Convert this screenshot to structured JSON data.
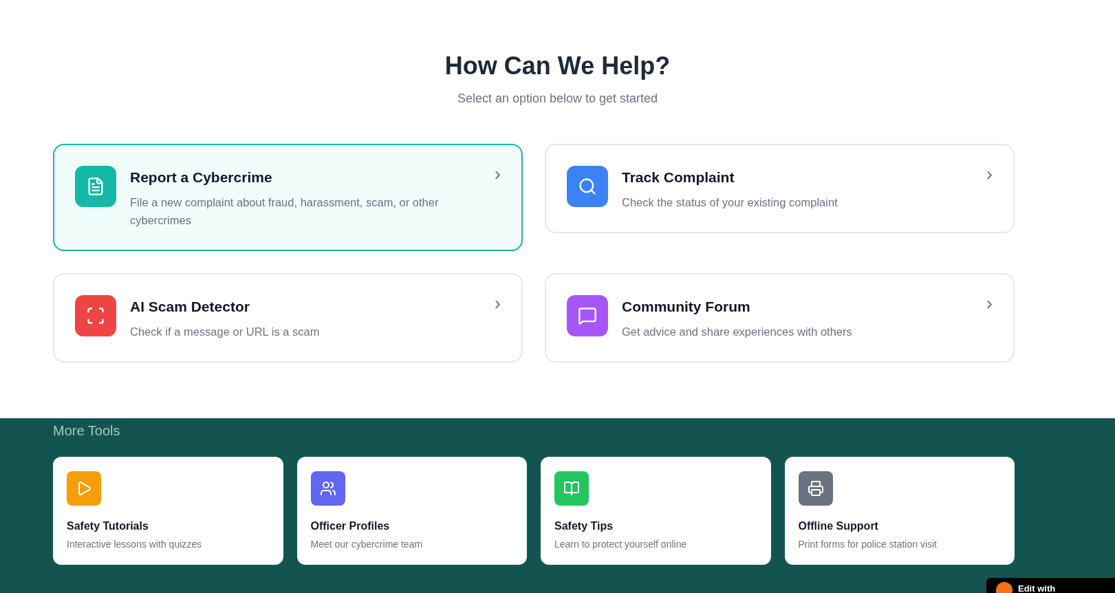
{
  "heading": "How Can We Help?",
  "subtitle": "Select an option below to get started",
  "options": [
    {
      "kind": "document",
      "title": "Report a Cybercrime",
      "description": "File a new complaint about fraud, harassment, scam, or other cybercrimes",
      "selected": true,
      "color": "#14b8a6",
      "chevron": "›"
    },
    {
      "kind": "search",
      "title": "Track Complaint",
      "description": "Check the status of your existing complaint",
      "selected": false,
      "color": "#3b82f6",
      "chevron": "›"
    },
    {
      "kind": "scan",
      "title": "AI Scam Detector",
      "description": "Check if a message or URL is a scam",
      "selected": false,
      "color": "#ef4444",
      "chevron": "›"
    },
    {
      "kind": "chat",
      "title": "Community Forum",
      "description": "Get advice and share experiences with others",
      "selected": false,
      "color": "#a855f7",
      "chevron": "›"
    }
  ],
  "more_tools": {
    "title": "More Tools",
    "items": [
      {
        "kind": "play",
        "title": "Safety Tutorials",
        "description": "Interactive lessons with quizzes",
        "color": "#f59e0b"
      },
      {
        "kind": "users",
        "title": "Officer Profiles",
        "description": "Meet our cybercrime team",
        "color": "#6366f1"
      },
      {
        "kind": "book",
        "title": "Safety Tips",
        "description": "Learn to protect yourself online",
        "color": "#22c55e"
      },
      {
        "kind": "printer",
        "title": "Offline Support",
        "description": "Print forms for police station visit",
        "color": "#6b7280"
      }
    ]
  },
  "badge": {
    "label": "Edit with"
  }
}
